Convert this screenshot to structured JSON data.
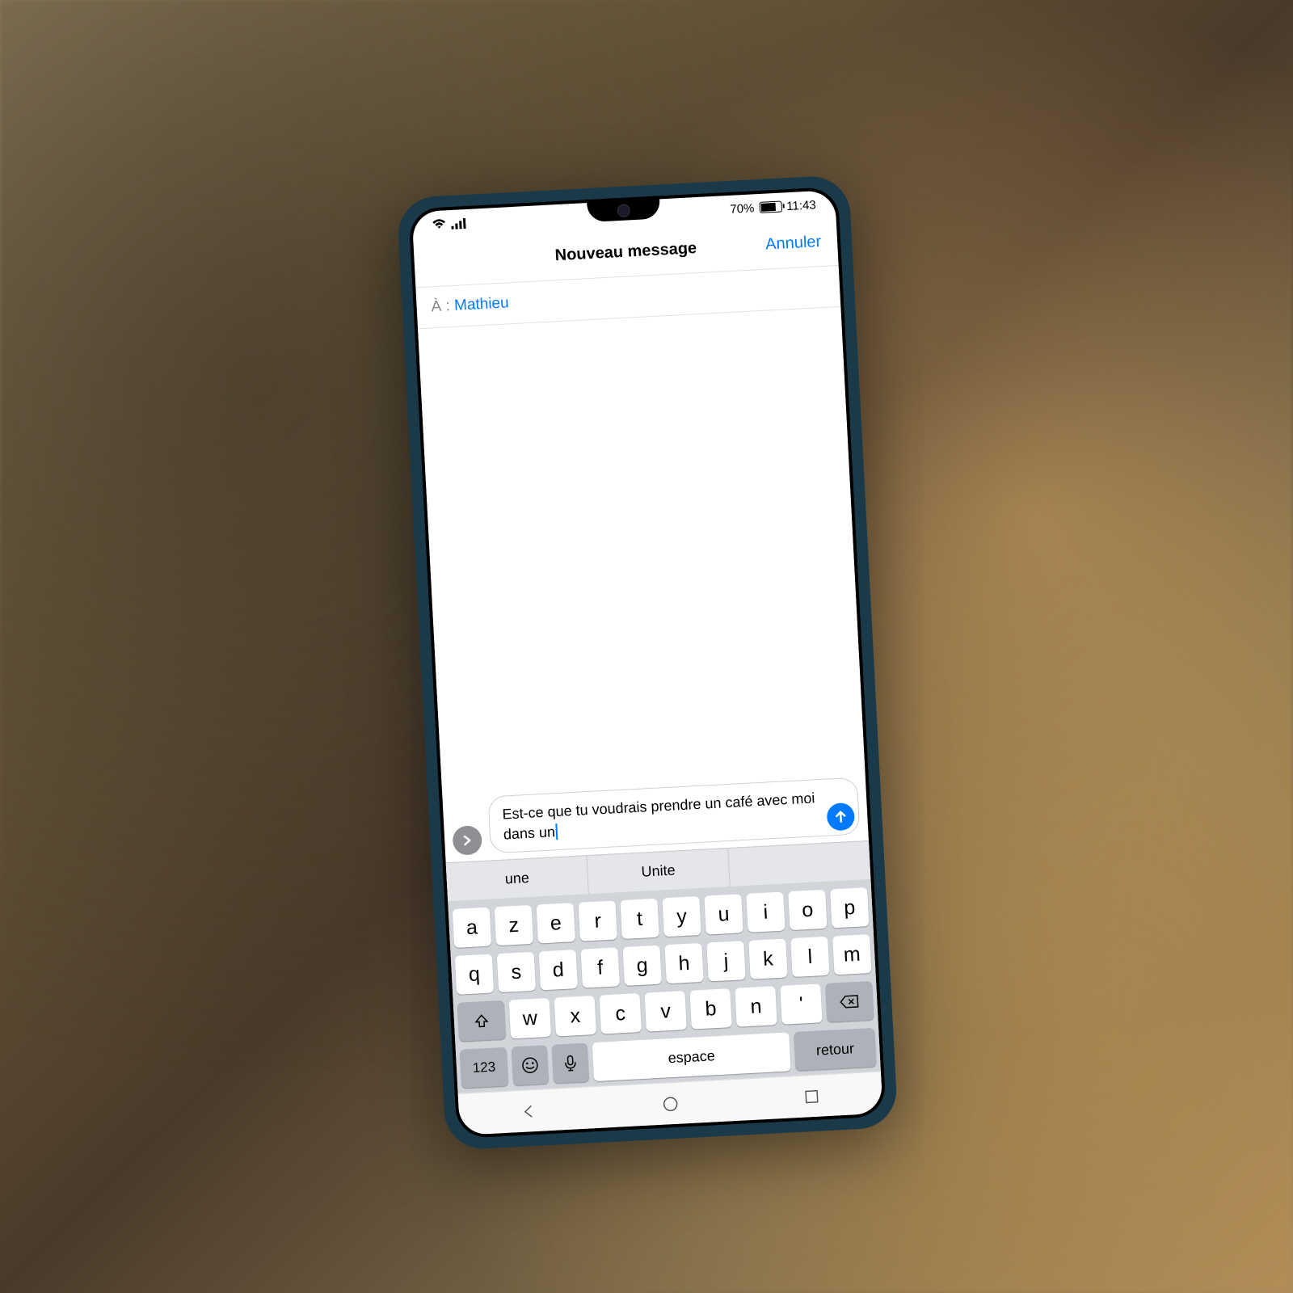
{
  "status": {
    "battery_pct": "70%",
    "time": "11:43"
  },
  "header": {
    "title": "Nouveau message",
    "cancel": "Annuler"
  },
  "recipient": {
    "label": "À : ",
    "name": "Mathieu"
  },
  "compose": {
    "text": "Est-ce que tu voudrais prendre un café avec moi dans un"
  },
  "suggestions": [
    "une",
    "Unite",
    ""
  ],
  "keyboard": {
    "row1": [
      "a",
      "z",
      "e",
      "r",
      "t",
      "y",
      "u",
      "i",
      "o",
      "p"
    ],
    "row2": [
      "q",
      "s",
      "d",
      "f",
      "g",
      "h",
      "j",
      "k",
      "l",
      "m"
    ],
    "row3": [
      "w",
      "x",
      "c",
      "v",
      "b",
      "n",
      "'"
    ],
    "space": "espace",
    "return": "retour",
    "numbers": "123"
  }
}
